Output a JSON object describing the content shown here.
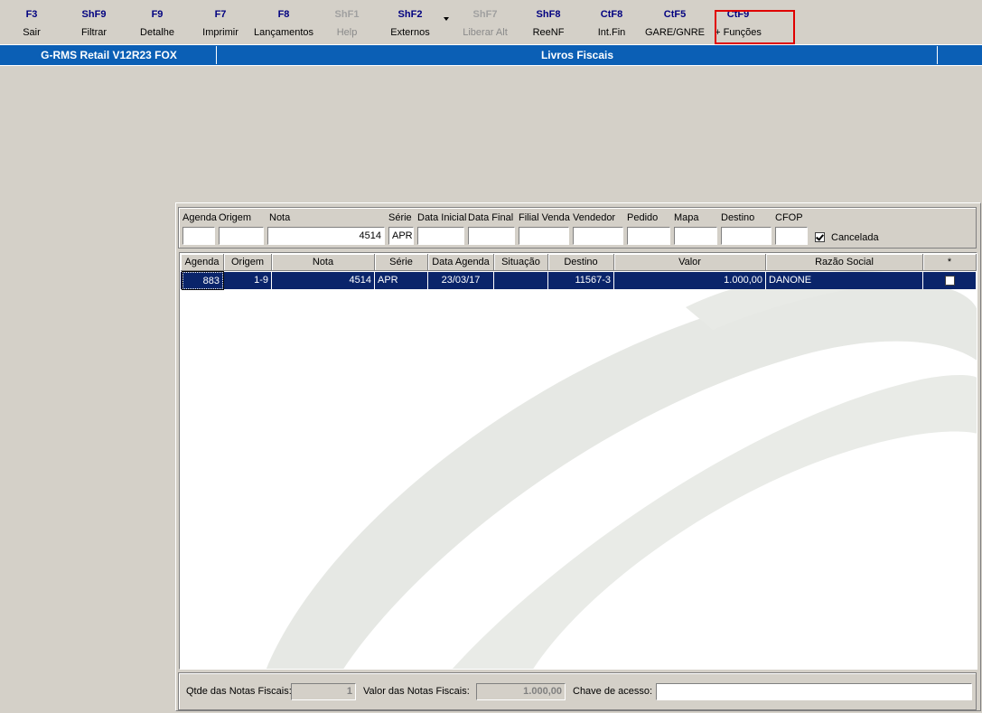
{
  "toolbar": {
    "buttons": [
      {
        "key": "F3",
        "label": "Sair"
      },
      {
        "key": "ShF9",
        "label": "Filtrar"
      },
      {
        "key": "F9",
        "label": "Detalhe"
      },
      {
        "key": "F7",
        "label": "Imprimir"
      },
      {
        "key": "F8",
        "label": "Lançamentos"
      },
      {
        "key": "ShF1",
        "label": "Help"
      },
      {
        "key": "ShF2",
        "label": "Externos"
      },
      {
        "key": "ShF7",
        "label": "Liberar Alt"
      },
      {
        "key": "ShF8",
        "label": "ReeNF"
      },
      {
        "key": "CtF8",
        "label": "Int.Fin"
      },
      {
        "key": "CtF5",
        "label": "GARE/GNRE"
      },
      {
        "key": "CtF9",
        "label": "+ Funções"
      }
    ]
  },
  "titlebar": {
    "app": "G-RMS Retail V12R23 FOX",
    "screen": "Livros Fiscais"
  },
  "filters": {
    "labels": {
      "agenda": "Agenda",
      "origem": "Origem",
      "nota": "Nota",
      "serie": "Série",
      "data_inicial": "Data Inicial",
      "data_final": "Data Final",
      "filial_venda": "Filial Venda",
      "vendedor": "Vendedor",
      "pedido": "Pedido",
      "mapa": "Mapa",
      "destino": "Destino",
      "cfop": "CFOP"
    },
    "values": {
      "agenda": "",
      "origem": "",
      "nota": "4514",
      "serie": "APR",
      "data_inicial": "",
      "data_final": "",
      "filial_venda": "",
      "vendedor": "",
      "pedido": "",
      "mapa": "",
      "destino": "",
      "cfop": ""
    },
    "cancelada_label": "Cancelada",
    "cancelada_checked": true
  },
  "grid": {
    "columns": [
      "Agenda",
      "Origem",
      "Nota",
      "Série",
      "Data Agenda",
      "Situação",
      "Destino",
      "Valor",
      "Razão Social",
      "*"
    ],
    "rows": [
      {
        "agenda": "883",
        "origem": "1-9",
        "nota": "4514",
        "serie": "APR",
        "data_agenda": "23/03/17",
        "situacao": "",
        "destino": "11567-3",
        "valor": "1.000,00",
        "razao_social": "DANONE",
        "flag": false
      }
    ],
    "selected_color": "#0a246a"
  },
  "footer": {
    "qtde_label": "Qtde das Notas Fiscais:",
    "qtde_value": "1",
    "valor_label": "Valor  das Notas Fiscais:",
    "valor_value": "1.000,00",
    "chave_label": "Chave de acesso:",
    "chave_value": ""
  }
}
